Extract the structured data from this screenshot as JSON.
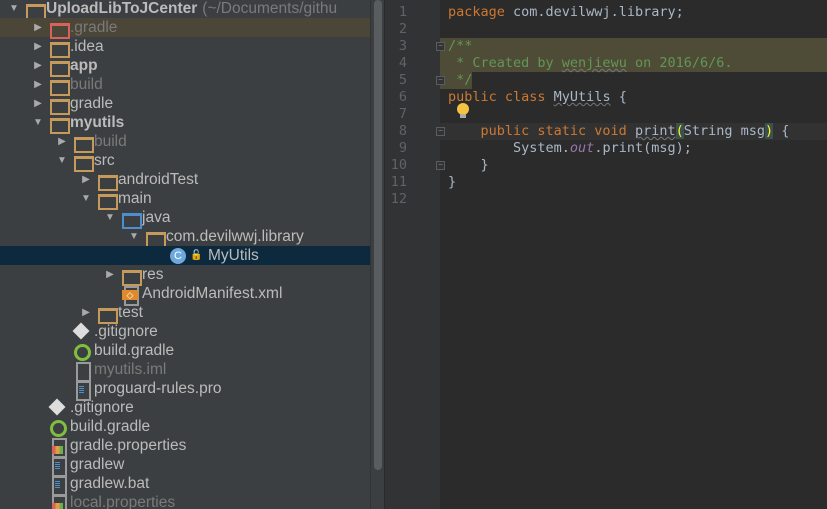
{
  "project_tree": {
    "items": [
      {
        "label": "UploadLibToJCenter",
        "suffix": "(~/Documents/githu",
        "level": 0,
        "arrow": "open",
        "icon": "module-folder-icon",
        "style": "bold"
      },
      {
        "label": ".gradle",
        "level": 1,
        "arrow": "closed",
        "icon": "excluded-folder-icon",
        "style": "dim",
        "row": "hl"
      },
      {
        "label": ".idea",
        "level": 1,
        "arrow": "closed",
        "icon": "folder-icon"
      },
      {
        "label": "app",
        "level": 1,
        "arrow": "closed",
        "icon": "android-module-icon",
        "style": "bold"
      },
      {
        "label": "build",
        "level": 1,
        "arrow": "closed",
        "icon": "folder-icon",
        "style": "dim"
      },
      {
        "label": "gradle",
        "level": 1,
        "arrow": "closed",
        "icon": "folder-icon"
      },
      {
        "label": "myutils",
        "level": 1,
        "arrow": "open",
        "icon": "library-module-icon",
        "style": "bold"
      },
      {
        "label": "build",
        "level": 2,
        "arrow": "closed",
        "icon": "folder-icon",
        "style": "dim"
      },
      {
        "label": "src",
        "level": 2,
        "arrow": "open",
        "icon": "folder-icon"
      },
      {
        "label": "androidTest",
        "level": 3,
        "arrow": "closed",
        "icon": "folder-icon"
      },
      {
        "label": "main",
        "level": 3,
        "arrow": "open",
        "icon": "folder-icon"
      },
      {
        "label": "java",
        "level": 4,
        "arrow": "open",
        "icon": "source-folder-icon"
      },
      {
        "label": "com.devilwwj.library",
        "level": 5,
        "arrow": "open",
        "icon": "package-icon"
      },
      {
        "label": "MyUtils",
        "level": 6,
        "arrow": "none",
        "icon": "class-icon",
        "row": "sel"
      },
      {
        "label": "res",
        "level": 4,
        "arrow": "closed",
        "icon": "resource-folder-icon"
      },
      {
        "label": "AndroidManifest.xml",
        "level": 4,
        "arrow": "none",
        "icon": "xml-file-icon"
      },
      {
        "label": "test",
        "level": 3,
        "arrow": "closed",
        "icon": "folder-icon"
      },
      {
        "label": ".gitignore",
        "level": 2,
        "arrow": "none",
        "icon": "git-icon"
      },
      {
        "label": "build.gradle",
        "level": 2,
        "arrow": "none",
        "icon": "gradle-icon"
      },
      {
        "label": "myutils.iml",
        "level": 2,
        "arrow": "none",
        "icon": "iml-file-icon",
        "style": "dim"
      },
      {
        "label": "proguard-rules.pro",
        "level": 2,
        "arrow": "none",
        "icon": "text-file-icon"
      },
      {
        "label": ".gitignore",
        "level": 1,
        "arrow": "none",
        "icon": "git-icon"
      },
      {
        "label": "build.gradle",
        "level": 1,
        "arrow": "none",
        "icon": "gradle-icon"
      },
      {
        "label": "gradle.properties",
        "level": 1,
        "arrow": "none",
        "icon": "properties-file-icon"
      },
      {
        "label": "gradlew",
        "level": 1,
        "arrow": "none",
        "icon": "text-file-icon"
      },
      {
        "label": "gradlew.bat",
        "level": 1,
        "arrow": "none",
        "icon": "text-file-icon"
      },
      {
        "label": "local.properties",
        "level": 1,
        "arrow": "none",
        "icon": "properties-file-icon",
        "style": "dim"
      }
    ]
  },
  "editor": {
    "lines": [
      {
        "n": "1",
        "tokens": [
          [
            "package",
            "k"
          ],
          [
            " com.devilwwj.library;",
            ""
          ]
        ]
      },
      {
        "n": "2",
        "tokens": []
      },
      {
        "n": "3",
        "bg": "doc",
        "fold": true,
        "tokens": [
          [
            "/**",
            "c"
          ]
        ]
      },
      {
        "n": "4",
        "bg": "doc",
        "tokens": [
          [
            " * Created by ",
            "c"
          ],
          [
            "wenjiewu",
            "c u"
          ],
          [
            " on 2016/6/6.",
            "c"
          ]
        ]
      },
      {
        "n": "5",
        "bg": "doc-short",
        "fold": true,
        "tokens": [
          [
            " */",
            "c"
          ]
        ]
      },
      {
        "n": "6",
        "tokens": [
          [
            "public class ",
            "k"
          ],
          [
            "MyUtils",
            "m"
          ],
          [
            " {",
            ""
          ]
        ]
      },
      {
        "n": "7",
        "tokens": []
      },
      {
        "n": "8",
        "bg": "cur",
        "fold": true,
        "tokens": [
          [
            "    public static void ",
            "k"
          ],
          [
            "print",
            "m"
          ],
          [
            "(",
            "b"
          ],
          [
            "String msg",
            ""
          ],
          [
            ")",
            "b"
          ],
          [
            " {",
            ""
          ]
        ]
      },
      {
        "n": "9",
        "tokens": [
          [
            "        System.",
            ""
          ],
          [
            "out",
            "f"
          ],
          [
            ".print(msg);",
            ""
          ]
        ]
      },
      {
        "n": "10",
        "fold": true,
        "tokens": [
          [
            "    }",
            ""
          ]
        ]
      },
      {
        "n": "11",
        "tokens": [
          [
            "}",
            ""
          ]
        ]
      },
      {
        "n": "12",
        "tokens": []
      }
    ]
  }
}
